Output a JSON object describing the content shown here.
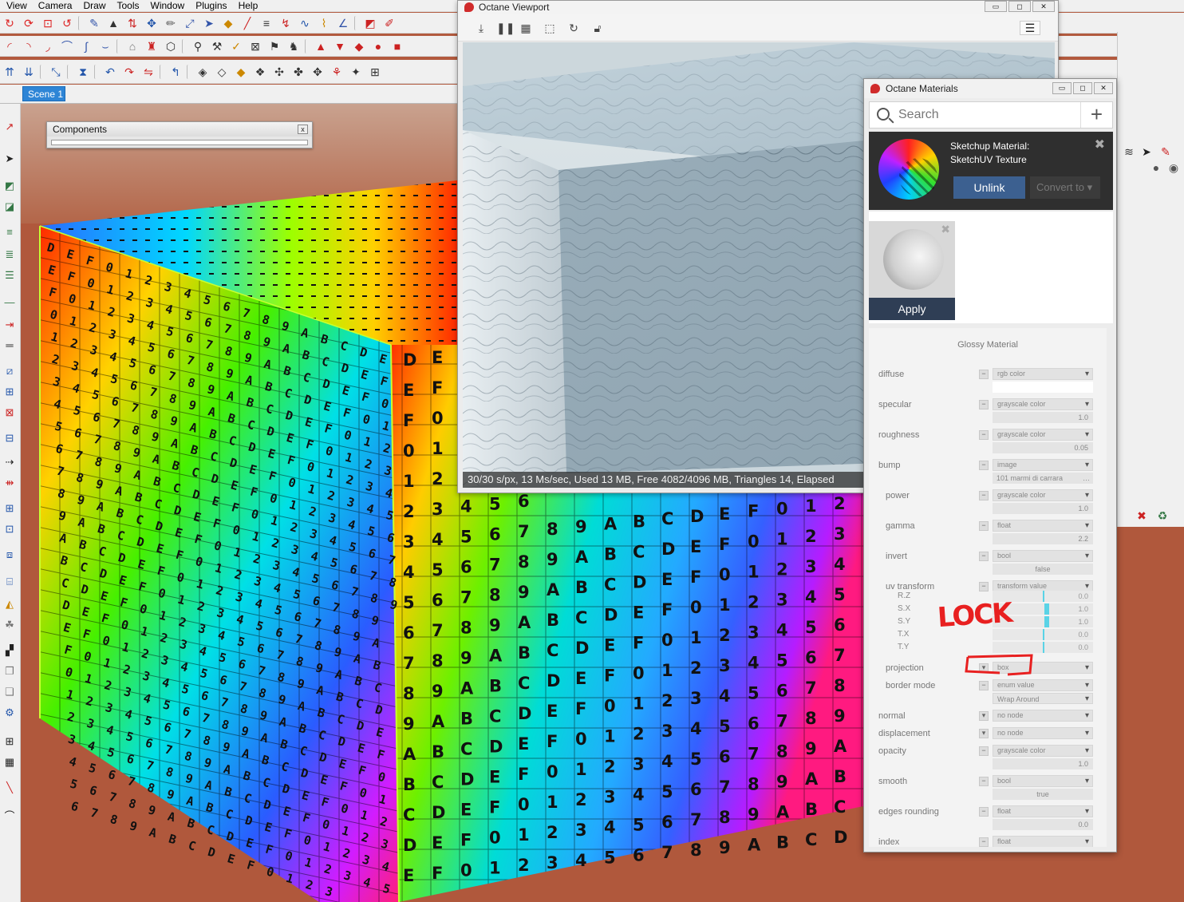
{
  "menu": [
    "View",
    "Camera",
    "Draw",
    "Tools",
    "Window",
    "Plugins",
    "Help"
  ],
  "scene_tab": "Scene 1",
  "components": {
    "title": "Components",
    "close": "x"
  },
  "viewport": {
    "title": "Octane Viewport",
    "status": "30/30 s/px, 13 Ms/sec, Used 13 MB, Free 4082/4096 MB, Triangles 14, Elapsed"
  },
  "materials": {
    "title": "Octane Materials",
    "search_placeholder": "Search",
    "sketchup_line1": "Sketchup Material:",
    "sketchup_line2": "SketchUV Texture",
    "unlink_label": "Unlink",
    "convert_label": "Convert to",
    "apply_label": "Apply",
    "section_title": "Glossy Material",
    "rows": {
      "diffuse": {
        "label": "diffuse",
        "type": "rgb color"
      },
      "specular": {
        "label": "specular",
        "type": "grayscale color",
        "value": "1.0",
        "fill": 1.0
      },
      "roughness": {
        "label": "roughness",
        "type": "grayscale color",
        "value": "0.05",
        "fill": 0.05
      },
      "bump": {
        "label": "bump",
        "type": "image",
        "value": "101 marmi di carrara"
      },
      "power": {
        "label": "power",
        "type": "grayscale color",
        "value": "1.0",
        "fill": 0.2
      },
      "gamma": {
        "label": "gamma",
        "type": "float",
        "value": "2.2",
        "fill": 0.26
      },
      "invert": {
        "label": "invert",
        "type": "bool",
        "value": "false"
      },
      "uv_transform": {
        "label": "uv transform",
        "type": "transform value"
      },
      "projection": {
        "label": "projection",
        "type": "box"
      },
      "border_mode": {
        "label": "border mode",
        "type": "enum value",
        "value": "Wrap Around"
      },
      "normal": {
        "label": "normal",
        "type": "no node"
      },
      "displacement": {
        "label": "displacement",
        "type": "no node"
      },
      "opacity": {
        "label": "opacity",
        "type": "grayscale color",
        "value": "1.0",
        "fill": 1.0
      },
      "smooth": {
        "label": "smooth",
        "type": "bool",
        "value": "true"
      },
      "edges_rounding": {
        "label": "edges rounding",
        "type": "float",
        "value": "0.0"
      },
      "index": {
        "label": "index",
        "type": "float"
      }
    },
    "uv": [
      {
        "label": "R.Z",
        "value": "0.0"
      },
      {
        "label": "S.X",
        "value": "1.0"
      },
      {
        "label": "S.Y",
        "value": "1.0"
      },
      {
        "label": "T.X",
        "value": "0.0"
      },
      {
        "label": "T.Y",
        "value": "0.0"
      }
    ]
  },
  "annotation": "LOCK",
  "cube": {
    "left_chars": "DEF0123456789ABCDEF0123456789ABC",
    "front_chars": "0123456789ABCDEF"
  },
  "colors": {
    "accent": "#2e85d6",
    "unlink": "#3c6090",
    "apply": "#2f3e55",
    "slider": "#5ad3e6",
    "annotation": "#e82020"
  }
}
